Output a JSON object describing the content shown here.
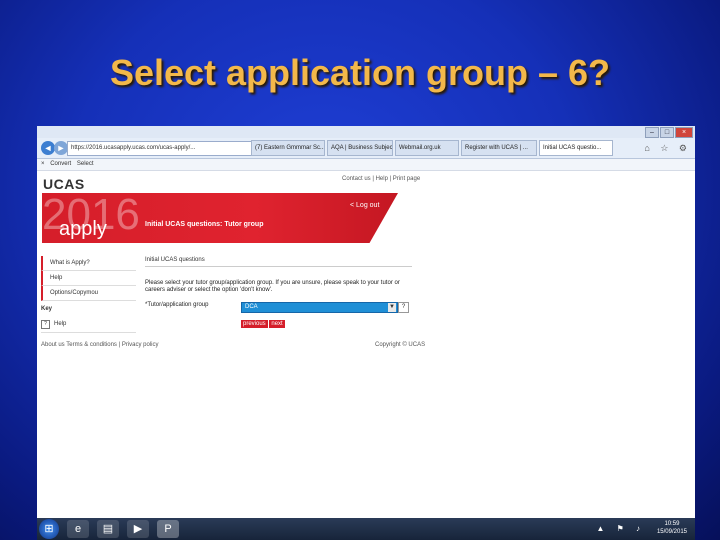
{
  "slide": {
    "title": "Select application group – 6?"
  },
  "browser": {
    "url": "https://2016.ucasapply.ucas.com/ucas-apply/...",
    "tabs": [
      {
        "label": "(7) Eastern Gmmmar Sc...",
        "active": false
      },
      {
        "label": "AQA | Business Subject...",
        "active": false
      },
      {
        "label": "Webmail.org.uk",
        "active": false
      },
      {
        "label": "Register with UCAS | ...",
        "active": false
      },
      {
        "label": "Initial UCAS questio...",
        "active": true
      }
    ],
    "toolbar": {
      "close": "×",
      "convert": "Convert",
      "select": "Select"
    },
    "window_controls": {
      "min": "–",
      "max": "□",
      "close": "×"
    },
    "nav": {
      "back": "◄",
      "forward": "►"
    },
    "right_icons": "⌂ ☆ ⚙"
  },
  "page": {
    "logo": "UCAS",
    "top_links": "Contact us | Help | Print page",
    "banner": {
      "year": "2016",
      "apply": "apply",
      "title": "Initial UCAS questions: Tutor group",
      "logout": "< Log out"
    },
    "sidebar": [
      {
        "label": "What is Apply?"
      },
      {
        "label": "Help"
      },
      {
        "label": "Options/Copymou"
      }
    ],
    "key_label": "Key",
    "help_icon": "?",
    "help_label": "Help",
    "section_heading": "Initial UCAS questions",
    "instructions": "Please select your tutor group/application group. If you are unsure, please speak to your tutor or careers adviser or select the option 'don't know'.",
    "field_label": "*Tutor/application group",
    "select_value": "DCA",
    "select_arrow": "▼",
    "qmark": "?",
    "previous": "previous",
    "next": "next",
    "footer_left": "About us   Terms & conditions | Privacy policy",
    "footer_right": "Copyright © UCAS"
  },
  "taskbar": {
    "start": "⊞",
    "apps": [
      {
        "icon": "e"
      },
      {
        "icon": "▤"
      },
      {
        "icon": "▶"
      },
      {
        "icon": "P"
      }
    ],
    "tray": "▲ ⚑ ♪",
    "time": "10:59",
    "date": "15/09/2015"
  }
}
